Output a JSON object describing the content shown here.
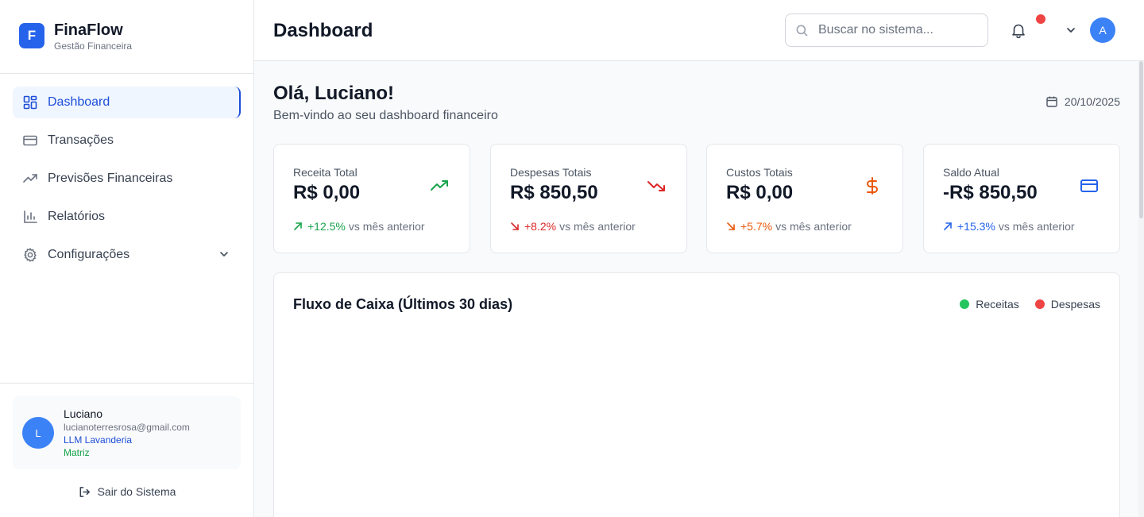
{
  "brand": {
    "logo_letter": "F",
    "name": "FinaFlow",
    "subtitle": "Gestão Financeira"
  },
  "sidebar": {
    "items": [
      {
        "label": "Dashboard",
        "icon": "dashboard-grid-icon",
        "active": true
      },
      {
        "label": "Transações",
        "icon": "credit-card-icon"
      },
      {
        "label": "Previsões Financeiras",
        "icon": "trending-up-icon"
      },
      {
        "label": "Relatórios",
        "icon": "bar-chart-icon"
      },
      {
        "label": "Configurações",
        "icon": "gear-icon",
        "expandable": true
      }
    ]
  },
  "user": {
    "initial": "L",
    "name": "Luciano",
    "email": "lucianoterresrosa@gmail.com",
    "company": "LLM Lavanderia",
    "branch": "Matriz",
    "logout_label": "Sair do Sistema"
  },
  "header": {
    "title": "Dashboard",
    "search_placeholder": "Buscar no sistema...",
    "avatar_initial": "A",
    "has_notification": true
  },
  "main": {
    "greeting": "Olá, Luciano!",
    "greeting_sub": "Bem-vindo ao seu dashboard financeiro",
    "date": "20/10/2025"
  },
  "cards": [
    {
      "label": "Receita Total",
      "value": "R$ 0,00",
      "trend": "+12.5%",
      "trend_suffix": "vs mês anterior",
      "color": "#16a34a",
      "icon": "trending-up-icon"
    },
    {
      "label": "Despesas Totais",
      "value": "R$ 850,50",
      "trend": "+8.2%",
      "trend_suffix": "vs mês anterior",
      "color": "#dc2626",
      "icon": "trending-down-icon"
    },
    {
      "label": "Custos Totais",
      "value": "R$ 0,00",
      "trend": "+5.7%",
      "trend_suffix": "vs mês anterior",
      "color": "#ea580c",
      "icon": "dollar-icon"
    },
    {
      "label": "Saldo Atual",
      "value": "-R$ 850,50",
      "trend": "+15.3%",
      "trend_suffix": "vs mês anterior",
      "color": "#2563eb",
      "icon": "credit-card-icon"
    }
  ],
  "chart": {
    "title": "Fluxo de Caixa (Últimos 30 dias)",
    "legend": [
      {
        "label": "Receitas",
        "color": "#22c55e"
      },
      {
        "label": "Despesas",
        "color": "#ef4444"
      }
    ]
  },
  "colors": {
    "accent": "#2563eb",
    "active_bg": "#eff6ff",
    "active_text": "#1d4ed8"
  }
}
